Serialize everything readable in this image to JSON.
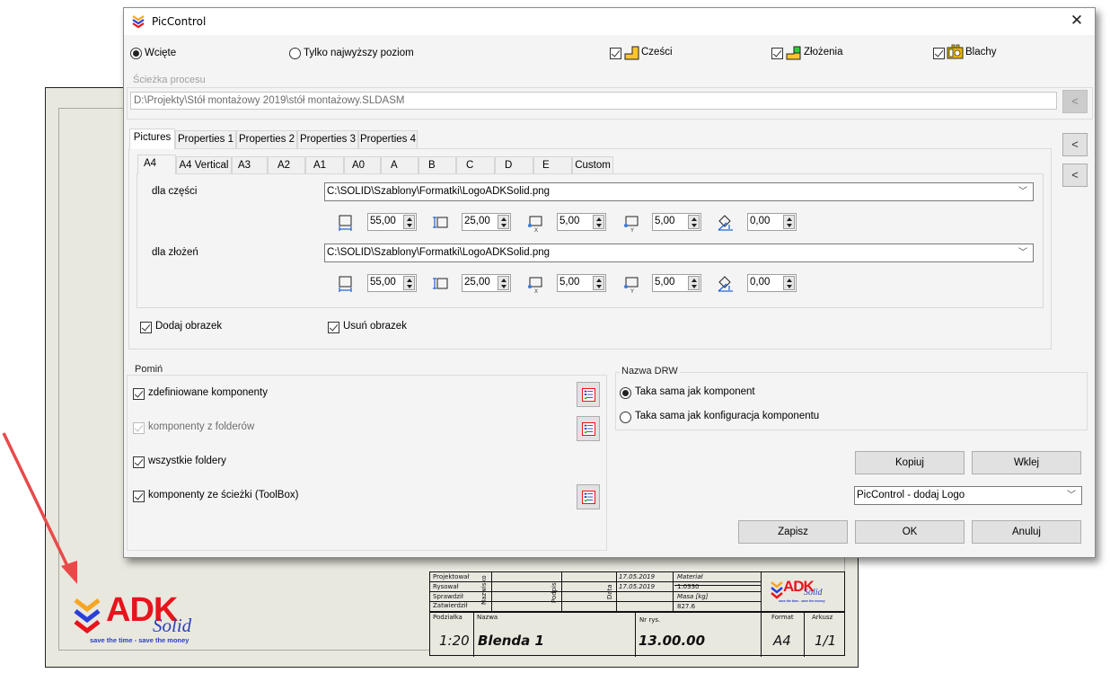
{
  "dialog": {
    "title": "PicControl",
    "close_icon": "close-icon",
    "mode_radios": [
      {
        "label": "Wcięte",
        "selected": true
      },
      {
        "label": "Tylko najwyższy poziom",
        "selected": false
      }
    ],
    "type_checks": [
      {
        "label": "Cześci",
        "checked": true,
        "icon": "part-icon"
      },
      {
        "label": "Złożenia",
        "checked": true,
        "icon": "assembly-icon"
      },
      {
        "label": "Blachy",
        "checked": true,
        "icon": "sheet-metal-icon"
      }
    ],
    "process_path": {
      "group_label": "Ścieżka procesu",
      "value": "D:\\Projekty\\Stół montażowy 2019\\stół montażowy.SLDASM",
      "browse_label": "<"
    },
    "side_buttons": [
      "<",
      "<"
    ],
    "main_tabs": [
      {
        "label": "Pictures",
        "active": true
      },
      {
        "label": "Properties 1",
        "active": false
      },
      {
        "label": "Properties 2",
        "active": false
      },
      {
        "label": "Properties 3",
        "active": false
      },
      {
        "label": "Properties 4",
        "active": false
      }
    ],
    "format_tabs": [
      {
        "label": "A4",
        "active": true
      },
      {
        "label": "A4 Vertical",
        "active": false
      },
      {
        "label": "A3",
        "active": false
      },
      {
        "label": "A2",
        "active": false
      },
      {
        "label": "A1",
        "active": false
      },
      {
        "label": "A0",
        "active": false
      },
      {
        "label": "A",
        "active": false
      },
      {
        "label": "B",
        "active": false
      },
      {
        "label": "C",
        "active": false
      },
      {
        "label": "D",
        "active": false
      },
      {
        "label": "E",
        "active": false
      },
      {
        "label": "Custom",
        "active": false
      }
    ],
    "picture_rows": [
      {
        "label": "dla części",
        "file": "C:\\SOLID\\Szablony\\Formatki\\LogoADKSolid.png",
        "params": [
          {
            "icon": "width-icon",
            "value": "55,00"
          },
          {
            "icon": "height-icon",
            "value": "25,00"
          },
          {
            "icon": "offset-x-icon",
            "value": "5,00"
          },
          {
            "icon": "offset-y-icon",
            "value": "5,00"
          },
          {
            "icon": "rotation-icon",
            "value": "0,00"
          }
        ]
      },
      {
        "label": "dla złożeń",
        "file": "C:\\SOLID\\Szablony\\Formatki\\LogoADKSolid.png",
        "params": [
          {
            "icon": "width-icon",
            "value": "55,00"
          },
          {
            "icon": "height-icon",
            "value": "25,00"
          },
          {
            "icon": "offset-x-icon",
            "value": "5,00"
          },
          {
            "icon": "offset-y-icon",
            "value": "5,00"
          },
          {
            "icon": "rotation-icon",
            "value": "0,00"
          }
        ]
      }
    ],
    "picture_checks": [
      {
        "label": "Dodaj obrazek",
        "checked": true
      },
      {
        "label": "Usuń obrazek",
        "checked": true
      }
    ],
    "skip_group": {
      "label": "Pomiń",
      "items": [
        {
          "label": "zdefiniowane komponenty",
          "checked": true,
          "enabled": true,
          "has_list": true
        },
        {
          "label": "komponenty z folderów",
          "checked": true,
          "enabled": false,
          "has_list": true
        },
        {
          "label": "wszystkie foldery",
          "checked": true,
          "enabled": true,
          "has_list": false
        },
        {
          "label": "komponenty ze ścieżki (ToolBox)",
          "checked": true,
          "enabled": true,
          "has_list": true
        }
      ]
    },
    "drw_group": {
      "label": "Nazwa DRW",
      "options": [
        {
          "label": "Taka sama jak komponent",
          "selected": true
        },
        {
          "label": "Taka sama jak konfiguracja komponentu",
          "selected": false
        }
      ]
    },
    "buttons": {
      "copy": "Kopiuj",
      "paste": "Wklej",
      "save": "Zapisz",
      "ok": "OK",
      "cancel": "Anuluj"
    },
    "preset_combo": "PicControl - dodaj Logo"
  },
  "drawing": {
    "logo": {
      "brand": "ADK",
      "sub": "Solid",
      "tagline": "save the time - save the money"
    },
    "title_block": {
      "rows": [
        "Projektował",
        "Rysował",
        "Sprawdził",
        "Zatwierdził"
      ],
      "col_nazwisko": "Nazwisko",
      "col_podpis": "Podpis",
      "col_data": "Data",
      "dates": [
        "17.05.2019",
        "17.05.2019"
      ],
      "material_label": "Materiał",
      "material_value": "1.0330",
      "mass_label": "Masa [kg]",
      "mass_value": "827.6",
      "scale_label": "Podziałka",
      "scale_value": "1:20",
      "name_label": "Nazwa",
      "name_value": "Blenda 1",
      "drawing_no_label": "Nr rys.",
      "drawing_no_value": "13.00.00",
      "format_label": "Format",
      "format_value": "A4",
      "sheet_label": "Arkusz",
      "sheet_value": "1/1"
    }
  }
}
